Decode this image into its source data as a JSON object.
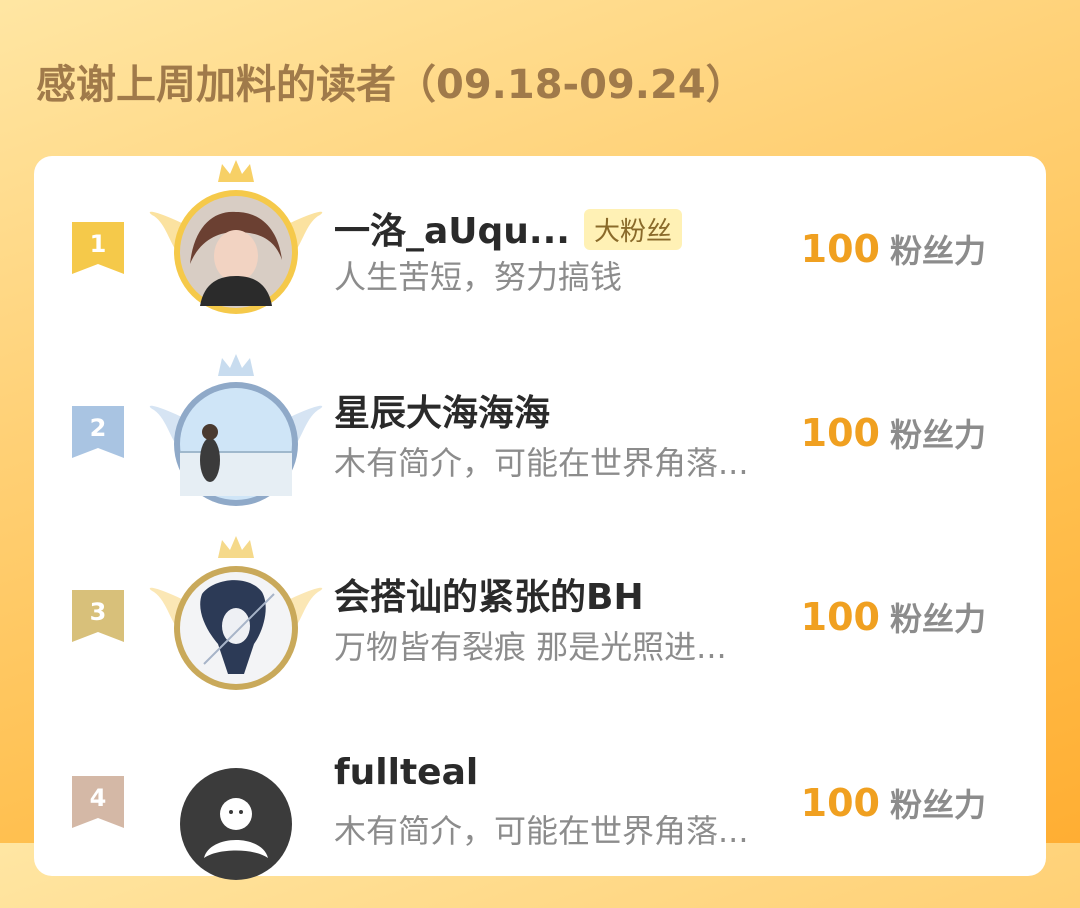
{
  "page": {
    "title": "感谢上周加料的读者（09.18-09.24）"
  },
  "colors": {
    "gold": "#f5c94a",
    "silver": "#a9c4e2",
    "bronze": "#d8c07a",
    "fourth": "#d4b8a6",
    "score": "#f0a020"
  },
  "readers": [
    {
      "rank": "1",
      "name": "一洛_aUqu...",
      "tag": "大粉丝",
      "bio": "人生苦短，努力搞钱",
      "score": "100",
      "unit": "粉丝力",
      "avatar_icon": "user-photo-avatar",
      "frame": "gold-crown-wings"
    },
    {
      "rank": "2",
      "name": "星辰大海海海",
      "tag": "",
      "bio": "木有简介，可能在世界角落...",
      "score": "100",
      "unit": "粉丝力",
      "avatar_icon": "user-photo-avatar",
      "frame": "silver-crown-wings"
    },
    {
      "rank": "3",
      "name": "会搭讪的紧张的BH",
      "tag": "",
      "bio": "万物皆有裂痕 那是光照进...",
      "score": "100",
      "unit": "粉丝力",
      "avatar_icon": "user-photo-avatar",
      "frame": "bronze-crown-wings"
    },
    {
      "rank": "4",
      "name": "fullteal",
      "tag": "",
      "bio": "木有简介，可能在世界角落...",
      "score": "100",
      "unit": "粉丝力",
      "avatar_icon": "default-user-avatar",
      "frame": "none"
    }
  ]
}
